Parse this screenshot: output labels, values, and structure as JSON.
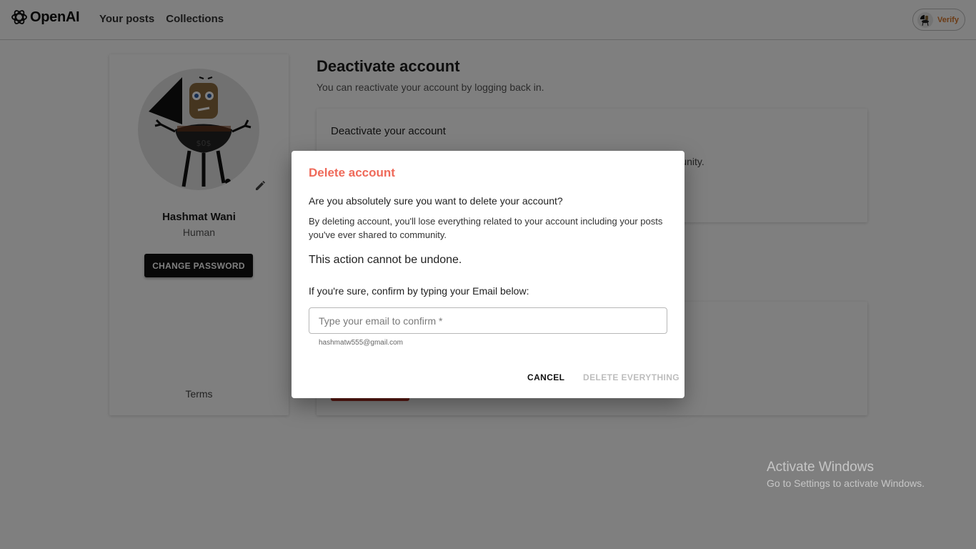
{
  "header": {
    "brand": "OpenAI",
    "nav": [
      {
        "label": "Your posts"
      },
      {
        "label": "Collections"
      }
    ],
    "verify_label": "Verify"
  },
  "profile": {
    "name": "Hashmat Wani",
    "role": "Human",
    "change_password_label": "CHANGE PASSWORD",
    "terms_label": "Terms"
  },
  "content": {
    "deactivate_title": "Deactivate account",
    "deactivate_subtitle": "You can reactivate your account by logging back in.",
    "deactivate_card_title": "Deactivate your account",
    "deactivate_card_text_visible": "mmunity."
  },
  "dialog": {
    "title": "Delete account",
    "question": "Are you absolutely sure you want to delete your account?",
    "warning": "By deleting account, you'll lose everything related to your account including your posts you've ever shared to community.",
    "undone": "This action cannot be undone.",
    "confirm_label": "If you're sure, confirm by typing your Email below:",
    "input_placeholder": "Type your email to confirm *",
    "input_value": "",
    "helper_email": "hashmatw555@gmail.com",
    "cancel_label": "CANCEL",
    "delete_label": "DELETE EVERYTHING",
    "title_color": "#ef6a5a"
  },
  "watermark": {
    "title": "Activate Windows",
    "subtitle": "Go to Settings to activate Windows."
  }
}
